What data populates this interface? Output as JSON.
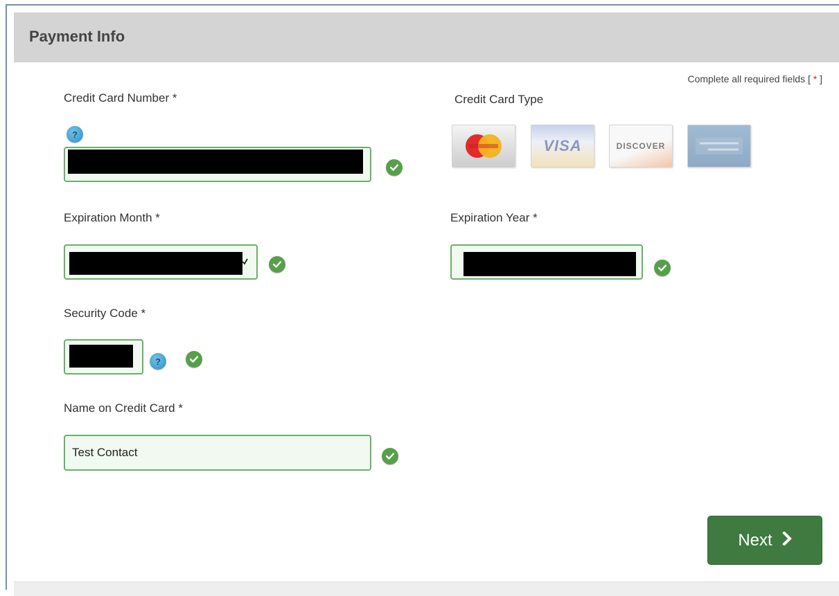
{
  "panel": {
    "title": "Payment Info",
    "required_note_text": "Complete all required fields [",
    "required_note_star": "*",
    "required_note_end": "]"
  },
  "fields": {
    "card_number": {
      "label": "Credit Card Number *",
      "help": "?"
    },
    "card_type": {
      "label": "Credit Card Type",
      "cards": [
        "mastercard-icon",
        "visa-icon",
        "discover-icon",
        "american-express-icon"
      ],
      "visa_label": "VISA",
      "discover_label": "DISCOVER"
    },
    "exp_month": {
      "label": "Expiration Month *"
    },
    "exp_year": {
      "label": "Expiration Year *"
    },
    "security_code": {
      "label": "Security Code *",
      "help": "?"
    },
    "name_on_card": {
      "label": "Name on Credit Card *",
      "value": "Test Contact"
    }
  },
  "actions": {
    "next_label": "Next"
  },
  "colors": {
    "valid_border": "#6cae6c",
    "check_green": "#56a04a",
    "button_green": "#3f7a40",
    "header_gray": "#d4d4d4",
    "help_blue": "#2f8fc2"
  }
}
